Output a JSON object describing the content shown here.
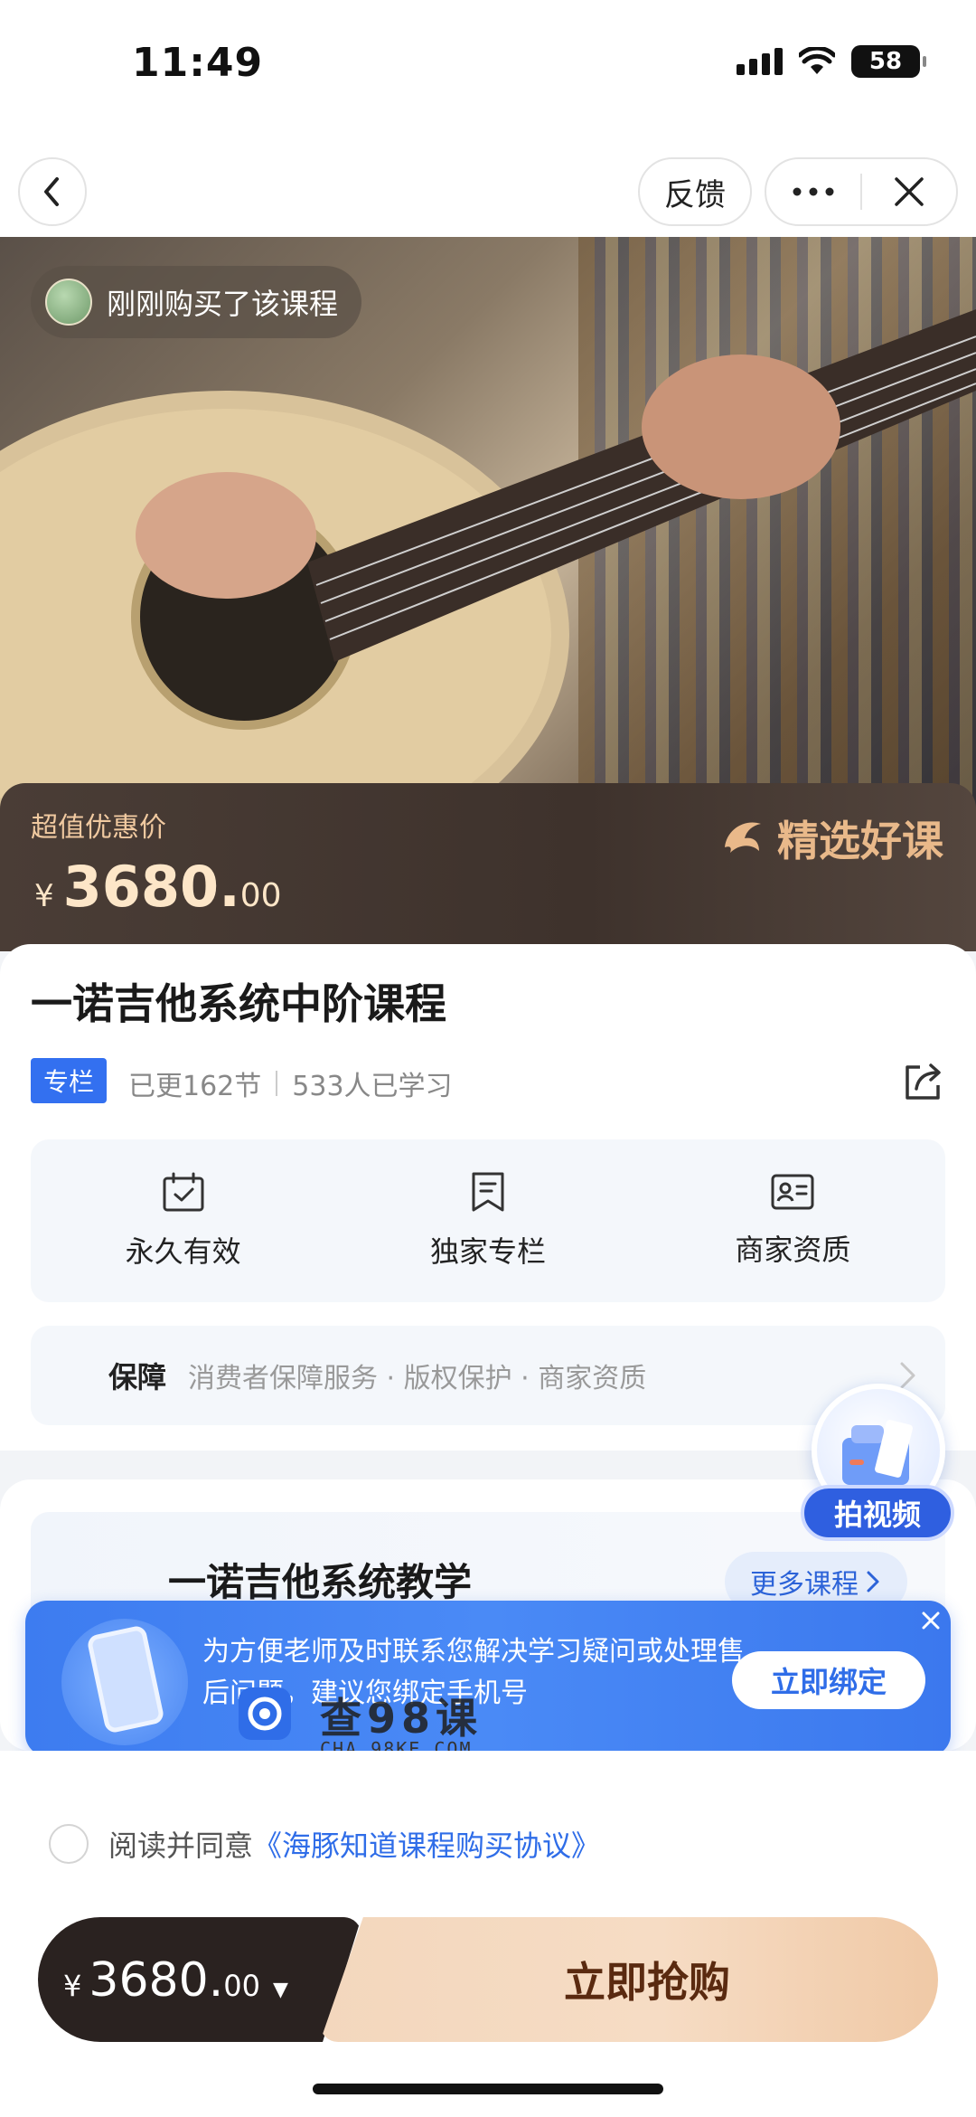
{
  "status_bar": {
    "time": "11:49",
    "battery": "58"
  },
  "nav": {
    "feedback": "反馈"
  },
  "hero": {
    "toast": "刚刚购买了该课程"
  },
  "price_band": {
    "label": "超值优惠价",
    "currency": "¥",
    "price_int": "3680.",
    "price_dec": "00",
    "brand": "精选好课"
  },
  "course": {
    "title": "一诺吉他系统中阶课程",
    "tag": "专栏",
    "updated": "已更162节",
    "learners": "533人已学习",
    "features": [
      {
        "icon": "calendar-check-icon",
        "label": "永久有效"
      },
      {
        "icon": "bookmark-icon",
        "label": "独家专栏"
      },
      {
        "icon": "id-card-icon",
        "label": "商家资质"
      }
    ],
    "guarantee": {
      "title": "保障",
      "items": "消费者保障服务 · 版权保护 · 商家资质"
    }
  },
  "series": {
    "title": "一诺吉他系统教学",
    "more": "更多课程"
  },
  "float_video": {
    "label": "拍视频"
  },
  "bind": {
    "text": "为方便老师及时联系您解决学习疑问或处理售后问题，建议您绑定手机号",
    "button": "立即绑定"
  },
  "watermark": {
    "text": "查98课",
    "url": "CHA.98KE.COM"
  },
  "agreement": {
    "prefix": "阅读并同意",
    "link": "《海豚知道课程购买协议》"
  },
  "bottom": {
    "currency": "¥",
    "price_int": "3680.",
    "price_dec": "00",
    "buy": "立即抢购"
  },
  "colors": {
    "accent": "#3370f0",
    "price_band": "#3e322c",
    "buy_button": "#f3d7bd"
  }
}
